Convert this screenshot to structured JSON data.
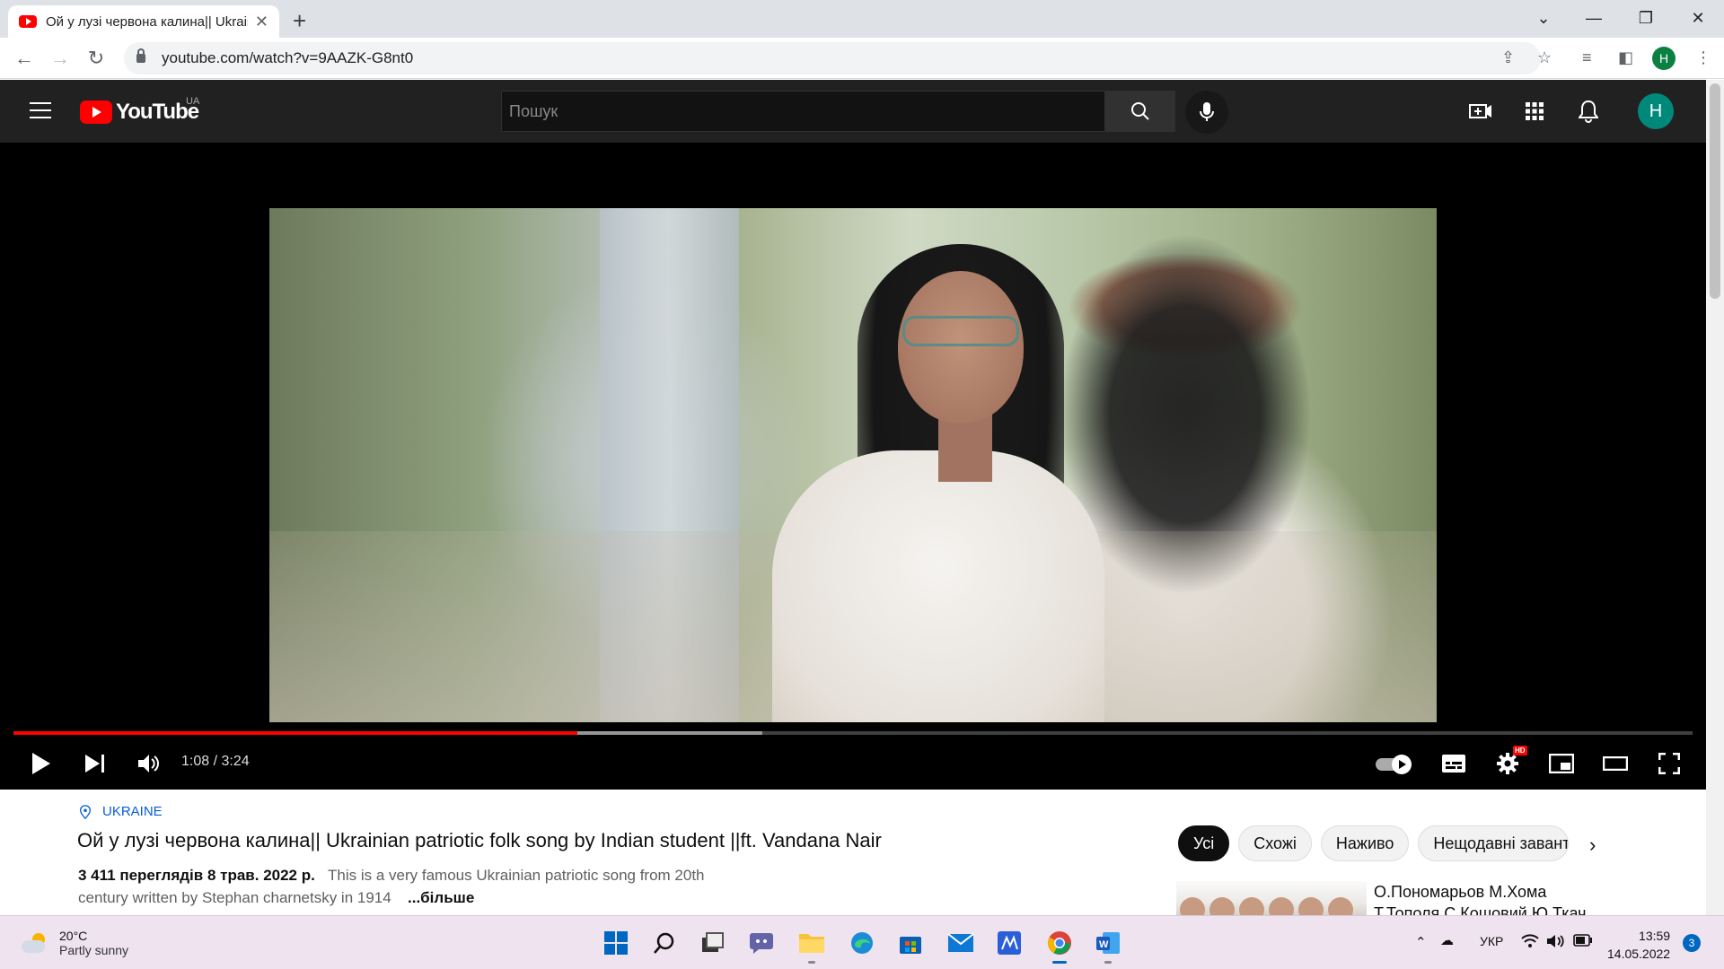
{
  "browser": {
    "tab_title": "Ой у лузі червона калина|| Ukrainian patriotic folk song by Indian student ||ft. Vandana Nair",
    "tab_close": "✕",
    "new_tab": "+",
    "url": "youtube.com/watch?v=9AAZK-G8nt0",
    "profile_initial": "H",
    "window_controls": {
      "tab_search": "⌄",
      "minimize": "—",
      "restore": "❐",
      "close": "✕"
    }
  },
  "youtube": {
    "logo_text": "YouTube",
    "region": "UA",
    "search_placeholder": "Пошук",
    "avatar_initial": "H"
  },
  "player": {
    "current_time": "1:08",
    "duration": "3:24",
    "time_display": "1:08 / 3:24",
    "progress_played": 0.336,
    "progress_buffered": 0.446,
    "hd_badge": "HD",
    "colors": {
      "played": "#ff0000",
      "background": "#000000"
    }
  },
  "video": {
    "hashtag": "UKRAINE",
    "title": "Ой у лузі червона калина|| Ukrainian patriotic folk song by Indian student ||ft. Vandana Nair",
    "views_and_date": "3 411 переглядів  8 трав. 2022 р.",
    "description_line1": "This is a very famous Ukrainian patriotic song from 20th",
    "description_line2": "century written by Stephan charnetsky in 1914",
    "more_label": "...більше"
  },
  "chips": [
    "Усі",
    "Схожі",
    "Наживо",
    "Нещодавні завантаження"
  ],
  "chip_next": "›",
  "recommendation": {
    "title_line1": "О.Пономарьов М.Хома",
    "title_line2": "Т.Тополя С.Кошовий Ю.Ткач"
  },
  "taskbar": {
    "weather_temp": "20°C",
    "weather_cond": "Partly sunny",
    "language": "УКР",
    "time": "13:59",
    "date": "14.05.2022",
    "notifications": "3"
  }
}
